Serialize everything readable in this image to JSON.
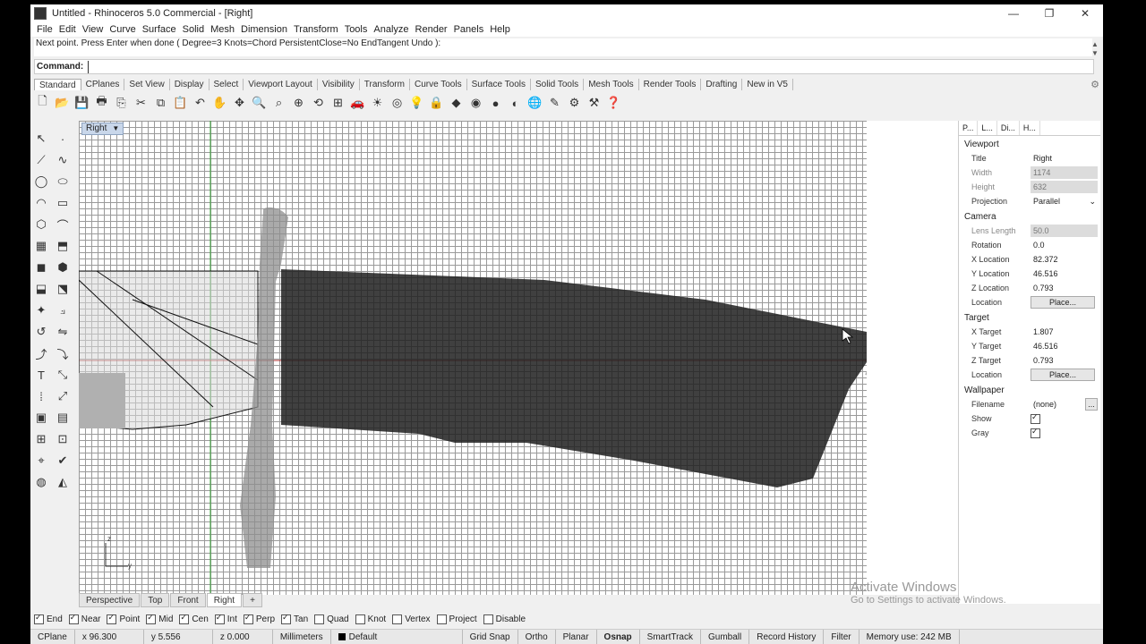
{
  "window": {
    "title": "Untitled - Rhinoceros 5.0 Commercial - [Right]",
    "controls": [
      "—",
      "❐",
      "✕"
    ]
  },
  "menu": [
    "File",
    "Edit",
    "View",
    "Curve",
    "Surface",
    "Solid",
    "Mesh",
    "Dimension",
    "Transform",
    "Tools",
    "Analyze",
    "Render",
    "Panels",
    "Help"
  ],
  "command": {
    "history": "Next point. Press Enter when done ( Degree=3  Knots=Chord  PersistentClose=No  EndTangent  Undo ):",
    "prompt": "Command:",
    "value": ""
  },
  "toolbar_tabs": [
    "Standard",
    "CPlanes",
    "Set View",
    "Display",
    "Select",
    "Viewport Layout",
    "Visibility",
    "Transform",
    "Curve Tools",
    "Surface Tools",
    "Solid Tools",
    "Mesh Tools",
    "Render Tools",
    "Drafting",
    "New in V5"
  ],
  "toolbar_icons": [
    "new-icon",
    "open-icon",
    "save-icon",
    "print-icon",
    "import-icon",
    "cut-icon",
    "copy-icon",
    "paste-icon",
    "undo-icon",
    "pan-icon",
    "move-icon",
    "zoom-icon",
    "zoom-window-icon",
    "zoom-extents-icon",
    "rotate-view-icon",
    "four-views-icon",
    "car-icon",
    "light-icon",
    "zoom-selected-icon",
    "bulb-icon",
    "lock-icon",
    "layer-icon",
    "color-wheel-icon",
    "sphere-icon",
    "shade-icon",
    "render-icon",
    "pencil-icon",
    "settings-icon",
    "options-icon",
    "help-icon"
  ],
  "viewport": {
    "label": "Right",
    "axis_labels": {
      "z": "z",
      "y": "y"
    }
  },
  "viewport_tabs": [
    "Perspective",
    "Top",
    "Front",
    "Right",
    "+"
  ],
  "osnap": [
    {
      "label": "End",
      "checked": true
    },
    {
      "label": "Near",
      "checked": true
    },
    {
      "label": "Point",
      "checked": true
    },
    {
      "label": "Mid",
      "checked": true
    },
    {
      "label": "Cen",
      "checked": true
    },
    {
      "label": "Int",
      "checked": true
    },
    {
      "label": "Perp",
      "checked": true
    },
    {
      "label": "Tan",
      "checked": true
    },
    {
      "label": "Quad",
      "checked": false
    },
    {
      "label": "Knot",
      "checked": false
    },
    {
      "label": "Vertex",
      "checked": false
    },
    {
      "label": "Project",
      "checked": false
    },
    {
      "label": "Disable",
      "checked": false
    }
  ],
  "status": {
    "cplane": "CPlane",
    "x": "x 96.300",
    "y": "y 5.556",
    "z": "z 0.000",
    "units": "Millimeters",
    "layer": "Default",
    "grid_snap": "Grid Snap",
    "ortho": "Ortho",
    "planar": "Planar",
    "osnap": "Osnap",
    "smarttrack": "SmartTrack",
    "gumball": "Gumball",
    "record_history": "Record History",
    "filter": "Filter",
    "memory": "Memory use: 242 MB"
  },
  "properties": {
    "tabs": [
      "P...",
      "L...",
      "Di...",
      "H..."
    ],
    "viewport_section": "Viewport",
    "title_label": "Title",
    "title_value": "Right",
    "width_label": "Width",
    "width_value": "1174",
    "height_label": "Height",
    "height_value": "632",
    "projection_label": "Projection",
    "projection_value": "Parallel",
    "camera_section": "Camera",
    "lens_label": "Lens Length",
    "lens_value": "50.0",
    "rotation_label": "Rotation",
    "rotation_value": "0.0",
    "xloc_label": "X Location",
    "xloc_value": "82.372",
    "yloc_label": "Y Location",
    "yloc_value": "46.516",
    "zloc_label": "Z Location",
    "zloc_value": "0.793",
    "location_label": "Location",
    "place_button": "Place...",
    "target_section": "Target",
    "xt_label": "X Target",
    "xt_value": "1.807",
    "yt_label": "Y Target",
    "yt_value": "46.516",
    "zt_label": "Z Target",
    "zt_value": "0.793",
    "tlocation_label": "Location",
    "tplace_button": "Place...",
    "wallpaper_section": "Wallpaper",
    "filename_label": "Filename",
    "filename_value": "(none)",
    "browse_button": "...",
    "show_label": "Show",
    "show_checked": true,
    "gray_label": "Gray",
    "gray_checked": true
  },
  "overlay": {
    "activate_title": "Activate Windows",
    "activate_sub": "Go to Settings to activate Windows."
  },
  "colors": {
    "viewport_label_bg": "#c9d7ea",
    "grid_line": "#9a9a9a",
    "x_axis": "#b03030",
    "y_axis": "#30a030"
  }
}
